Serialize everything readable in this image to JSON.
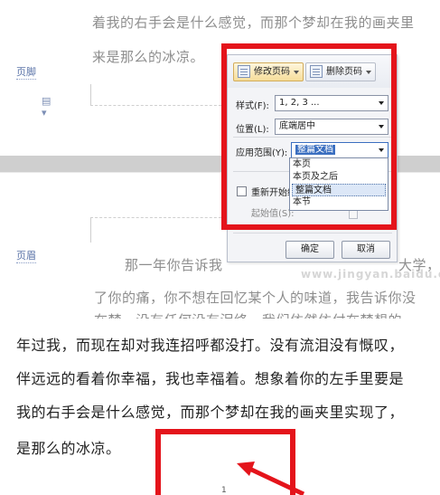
{
  "document": {
    "upper_lines": [
      "着我的右手会是什么感觉，而那个梦却在我的画夹里",
      "来是那么的冰凉。"
    ],
    "footer_tag": "页脚",
    "header_tag": "页眉",
    "middle_lines": [
      "那一年你告诉我",
      "大学，",
      "了你的痛，你不想在回忆某个人的味道，我告诉你没",
      "在梦，没有任何没有泪终，我们依然依付在梦想的"
    ],
    "lower_lines": [
      "年过我，而现在却对我连招呼都没打。没有流泪没有慨叹，",
      "伴远远的看着你幸福，我也幸福着。想象着你的左手里要是",
      "我的右手会是什么感觉，而那个梦却在我的画夹里实现了，",
      "是那么的冰凉。"
    ],
    "page_number": "1",
    "watermark": "www.jingyan.baidu.com"
  },
  "dialog": {
    "tab_modify": "修改页码",
    "tab_delete": "删除页码",
    "style_label": "样式(F):",
    "style_value": "1, 2, 3 ...",
    "position_label": "位置(L):",
    "position_value": "底端居中",
    "range_label": "应用范围(Y):",
    "range_value": "整篇文档",
    "range_options": [
      "本页",
      "本页及之后",
      "整篇文档",
      "本节"
    ],
    "restart_label": "重新开始编",
    "start_label": "起始值(S):",
    "ok_label": "确定",
    "cancel_label": "取消"
  },
  "colors": {
    "highlight_red": "#e4141b",
    "active_tab": "#f6dd9a",
    "selection_blue": "#3b6fc0"
  }
}
